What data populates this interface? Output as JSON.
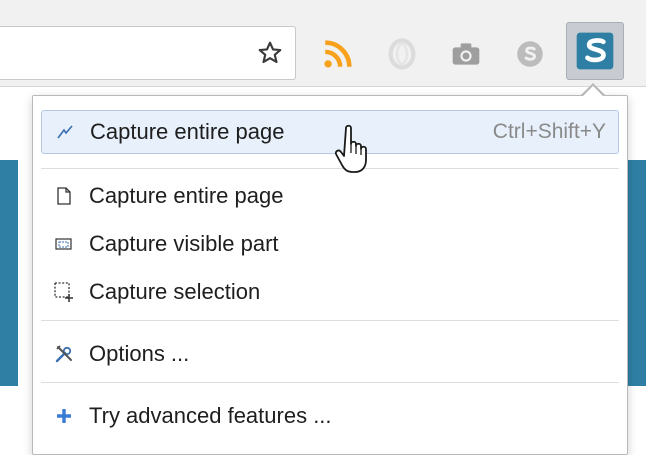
{
  "menu": {
    "items": [
      {
        "label": "Capture entire page",
        "shortcut": "Ctrl+Shift+Y"
      },
      {
        "label": "Capture entire page"
      },
      {
        "label": "Capture visible part"
      },
      {
        "label": "Capture selection"
      },
      {
        "label": "Options ..."
      },
      {
        "label": "Try advanced features ..."
      }
    ]
  },
  "colors": {
    "rss": "#f7a11c",
    "accent_blue": "#2f7fa4",
    "highlight": "#e8f0fb"
  },
  "icons": {
    "toolbar": [
      "star-icon",
      "rss-icon",
      "opera-icon",
      "camera-icon",
      "skype-icon",
      "screenshot-extension-icon"
    ],
    "menu": [
      "capture-page-icon",
      "page-icon",
      "visible-part-icon",
      "selection-icon",
      "options-icon",
      "plus-icon"
    ]
  }
}
